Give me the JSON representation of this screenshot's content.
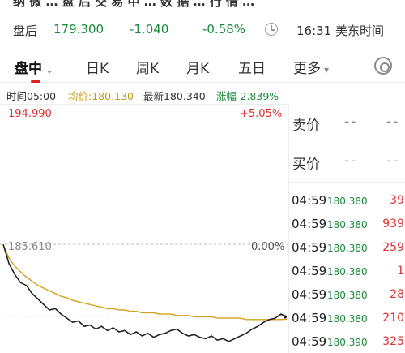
{
  "header": {
    "title_cut": "纳 微 … 盘 后 交 易 中 … 数 据 … 行 情 …"
  },
  "quote": {
    "label": "盘后",
    "price": "179.300",
    "change": "-1.040",
    "change_pct": "-0.58%",
    "time": "16:31 美东时间"
  },
  "tabs": [
    {
      "label": "盘中",
      "active": true
    },
    {
      "label": "日K"
    },
    {
      "label": "周K"
    },
    {
      "label": "月K"
    },
    {
      "label": "五日"
    },
    {
      "label": "更多"
    }
  ],
  "info": {
    "time": "时间05:00",
    "avg": "均价:180.130",
    "last": "最新180.340",
    "chg": "涨幅-2.839%"
  },
  "chart": {
    "high": "194.990",
    "high_pct": "+5.05%",
    "prev_close": "185.610",
    "prev_pct": "0.00%"
  },
  "chart_data": {
    "type": "line",
    "ylim": [
      176.23,
      194.99
    ],
    "reference": 185.61,
    "series": [
      {
        "name": "price",
        "color": "#222222",
        "values": [
          185.6,
          184.2,
          183.4,
          182.8,
          182.6,
          182.0,
          181.6,
          181.2,
          180.8,
          180.9,
          180.5,
          180.2,
          179.9,
          180.0,
          179.6,
          179.7,
          179.4,
          179.6,
          179.3,
          179.5,
          179.2,
          179.3,
          179.0,
          179.2,
          178.9,
          179.1,
          178.8,
          179.0,
          179.1,
          179.3,
          179.4,
          179.1,
          178.9,
          179.0,
          178.8,
          178.7,
          178.9,
          178.6,
          178.7,
          178.5,
          178.7,
          178.9,
          179.1,
          179.4,
          179.6,
          179.9,
          180.1,
          180.2,
          180.5,
          180.3
        ]
      },
      {
        "name": "avg",
        "color": "#d4a017",
        "values": [
          185.6,
          184.6,
          184.0,
          183.6,
          183.2,
          182.9,
          182.6,
          182.4,
          182.2,
          182.0,
          181.8,
          181.7,
          181.5,
          181.4,
          181.3,
          181.2,
          181.1,
          181.0,
          180.9,
          180.9,
          180.8,
          180.8,
          180.7,
          180.7,
          180.6,
          180.6,
          180.6,
          180.5,
          180.5,
          180.5,
          180.4,
          180.4,
          180.4,
          180.3,
          180.3,
          180.3,
          180.3,
          180.2,
          180.2,
          180.2,
          180.2,
          180.2,
          180.1,
          180.1,
          180.1,
          180.1,
          180.1,
          180.1,
          180.1,
          180.13
        ]
      }
    ]
  },
  "orderbook": {
    "ask_label": "卖价",
    "bid_label": "买价",
    "ask_v1": "--",
    "ask_v2": "--",
    "bid_v1": "--",
    "bid_v2": "--"
  },
  "ticks": [
    {
      "time": "04:59",
      "price": "180.380",
      "vol": "39"
    },
    {
      "time": "04:59",
      "price": "180.380",
      "vol": "939"
    },
    {
      "time": "04:59",
      "price": "180.380",
      "vol": "259"
    },
    {
      "time": "04:59",
      "price": "180.380",
      "vol": "1"
    },
    {
      "time": "04:59",
      "price": "180.380",
      "vol": "28"
    },
    {
      "time": "04:59",
      "price": "180.380",
      "vol": "210"
    },
    {
      "time": "04:59",
      "price": "180.390",
      "vol": "325"
    }
  ]
}
